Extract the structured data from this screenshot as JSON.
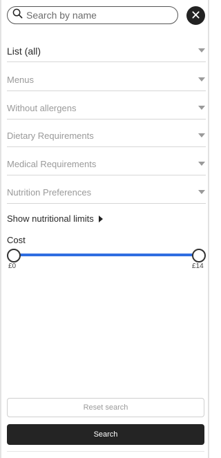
{
  "search": {
    "placeholder": "Search by name",
    "value": ""
  },
  "filters": [
    {
      "label": "List (all)"
    },
    {
      "label": "Menus"
    },
    {
      "label": "Without allergens"
    },
    {
      "label": "Dietary Requirements"
    },
    {
      "label": "Medical Requirements"
    },
    {
      "label": "Nutrition Preferences"
    }
  ],
  "nutrition_toggle": "Show nutritional limits",
  "cost": {
    "label": "Cost",
    "min_label": "£0",
    "max_label": "£14",
    "accent": "#2f6de1"
  },
  "buttons": {
    "reset": "Reset search",
    "search": "Search"
  },
  "icons": {
    "search": "search-icon",
    "close": "close-icon",
    "caret": "caret-down-icon",
    "expand": "triangle-right-icon"
  }
}
